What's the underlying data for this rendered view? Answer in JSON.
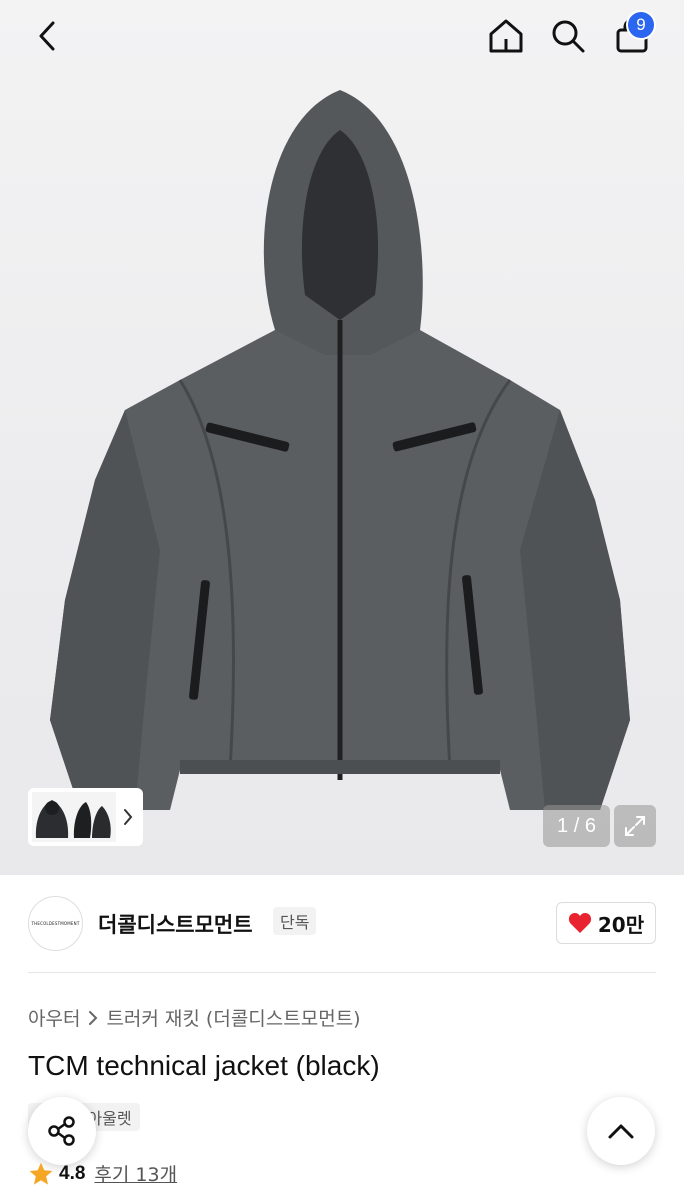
{
  "header": {
    "cart_count": "9",
    "icons": [
      "chevron-left-icon",
      "home-icon",
      "search-icon",
      "shopping-bag-icon"
    ]
  },
  "gallery": {
    "counter": "1 / 6",
    "colors": {
      "jacket": "#5a5d60",
      "overlay": "#969696"
    }
  },
  "brand": {
    "name": "더콜디스트모먼트",
    "tag": "단독",
    "logo_text": "THECOLDESTMOMENT",
    "likes": "20만",
    "heart_color": "#e8232f"
  },
  "breadcrumb": {
    "items": [
      "아우터",
      "트러커 재킷 (더콜디스트모먼트)"
    ]
  },
  "product": {
    "title": "TCM technical jacket (black)",
    "tags": [
      "단독",
      "아울렛"
    ]
  },
  "rating": {
    "value": "4.8",
    "reviews": "후기 13개",
    "star_color": "#f5a623"
  }
}
